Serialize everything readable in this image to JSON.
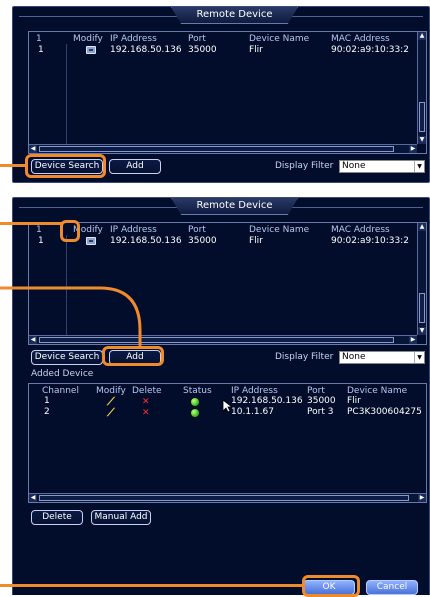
{
  "panel_top": {
    "title": "Remote Device",
    "columns": [
      "1",
      "Modify",
      "IP Address",
      "Port",
      "Device Name",
      "MAC Address"
    ],
    "rows": [
      {
        "num": "1",
        "ip": "192.168.50.136",
        "port": "35000",
        "name": "Flir",
        "mac": "90:02:a9:10:33:2"
      }
    ],
    "device_search_label": "Device Search",
    "add_label": "Add",
    "display_filter_label": "Display Filter",
    "display_filter_value": "None"
  },
  "panel_bottom": {
    "title": "Remote Device",
    "columns": [
      "1",
      "Modify",
      "IP Address",
      "Port",
      "Device Name",
      "MAC Address"
    ],
    "rows": [
      {
        "num": "1",
        "ip": "192.168.50.136",
        "port": "35000",
        "name": "Flir",
        "mac": "90:02:a9:10:33:2"
      }
    ],
    "device_search_label": "Device Search",
    "add_label": "Add",
    "display_filter_label": "Display Filter",
    "display_filter_value": "None",
    "added_device_label": "Added Device",
    "added_columns": [
      "Channel",
      "Modify",
      "Delete",
      "Status",
      "IP Address",
      "Port",
      "Device Name"
    ],
    "added_rows": [
      {
        "channel": "1",
        "ip": "192.168.50.136",
        "port": "35000",
        "name": "Flir"
      },
      {
        "channel": "2",
        "ip": "10.1.1.67",
        "port": "Port 3",
        "name": "PC3K300604275"
      }
    ],
    "delete_label": "Delete",
    "manual_add_label": "Manual Add",
    "ok_label": "OK",
    "cancel_label": "Cancel"
  },
  "colors": {
    "accent_orange": "#ef8a2d",
    "panel_bg": "#020d2b",
    "status_green": "#3fbf1c"
  }
}
